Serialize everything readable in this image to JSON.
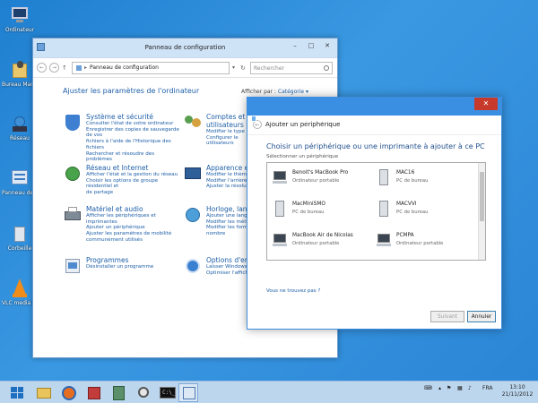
{
  "desktop": {
    "icons": [
      {
        "label": "Ordinateur",
        "icon": "computer-icon"
      },
      {
        "label": "Bureau Maria",
        "icon": "user-folder-icon"
      },
      {
        "label": "Réseau",
        "icon": "network-icon"
      },
      {
        "label": "Panneau de configuration",
        "icon": "control-panel-icon"
      },
      {
        "label": "Corbeille",
        "icon": "recycle-bin-icon"
      },
      {
        "label": "VLC media player",
        "icon": "vlc-icon"
      }
    ]
  },
  "control_panel": {
    "title": "Panneau de configuration",
    "address": "Panneau de configuration",
    "search_placeholder": "Rechercher",
    "heading": "Ajuster les paramètres de l'ordinateur",
    "view_by_label": "Afficher par :",
    "view_by_value": "Catégorie",
    "categories": [
      {
        "title": "Système et sécurité",
        "icon": "shield-icon",
        "links": [
          "Consulter l'état de votre ordinateur",
          "Enregistrer des copies de sauvegarde de vos",
          "fichiers à l'aide de l'Historique des fichiers",
          "Rechercher et résoudre des problèmes"
        ]
      },
      {
        "title": "Réseau et Internet",
        "icon": "network-globe-icon",
        "links": [
          "Afficher l'état et la gestion du réseau",
          "Choisir les options de groupe résidentiel et",
          "de partage"
        ]
      },
      {
        "title": "Matériel et audio",
        "icon": "printer-icon",
        "links": [
          "Afficher les périphériques et imprimantes",
          "Ajouter un périphérique",
          "Ajuster les paramètres de mobilité",
          "communément utilisés"
        ]
      },
      {
        "title": "Programmes",
        "icon": "programs-icon",
        "links": [
          "Désinstaller un programme"
        ]
      },
      {
        "title": "Comptes et",
        "title2": "utilisateurs",
        "icon": "users-icon",
        "links": [
          "Modifier le type",
          "Configurer le",
          "utilisateurs"
        ]
      },
      {
        "title": "Apparence et p",
        "icon": "appearance-icon",
        "links": [
          "Modifier le thème",
          "Modifier l'arrière-pl",
          "Ajuster la résolution"
        ]
      },
      {
        "title": "Horloge, langue",
        "icon": "clock-globe-icon",
        "links": [
          "Ajouter une langue",
          "Modifier les méthodes",
          "Modifier les formats",
          "nombre"
        ]
      },
      {
        "title": "Options d'ergo",
        "icon": "ease-of-access-icon",
        "links": [
          "Laisser Windows sug",
          "Optimiser l'affichage"
        ]
      }
    ]
  },
  "dialog": {
    "title": "Ajouter un périphérique",
    "heading": "Choisir un périphérique ou une imprimante à ajouter à ce PC",
    "subheading": "Sélectionner un périphérique",
    "devices": [
      {
        "name": "Benoit's MacBook Pro",
        "type": "Ordinateur portable",
        "icon": "laptop-icon"
      },
      {
        "name": "MAC16",
        "type": "PC de bureau",
        "icon": "desktop-pc-icon"
      },
      {
        "name": "MacMiniSMO",
        "type": "PC de bureau",
        "icon": "desktop-pc-icon"
      },
      {
        "name": "MACVVI",
        "type": "PC de bureau",
        "icon": "desktop-pc-icon"
      },
      {
        "name": "MacBook Air de Nicolas",
        "type": "Ordinateur portable",
        "icon": "laptop-icon"
      },
      {
        "name": "PCMPA",
        "type": "Ordinateur portable",
        "icon": "laptop-icon"
      }
    ],
    "not_found_link": "Vous ne trouvez pas ?",
    "next_label": "Suivant",
    "cancel_label": "Annuler"
  },
  "taskbar": {
    "language": "FRA",
    "time": "13:10",
    "date": "21/11/2012"
  }
}
